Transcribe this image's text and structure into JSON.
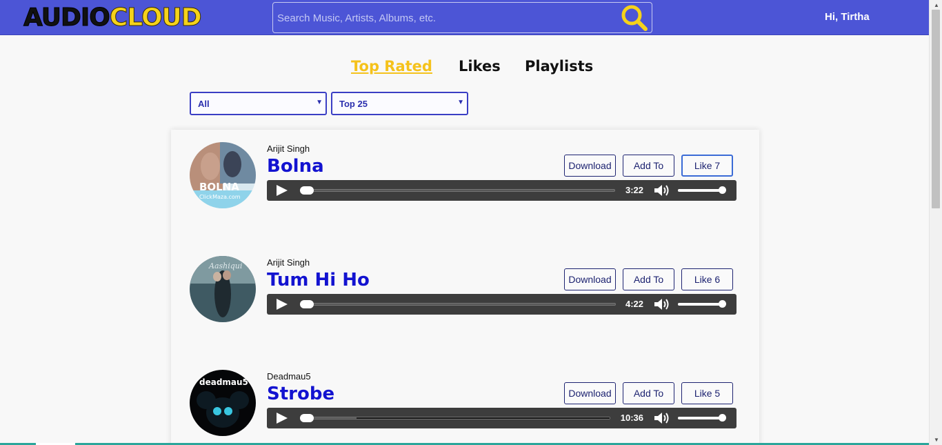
{
  "header": {
    "logo_part1": "AUDIO",
    "logo_part2": "CLOUD",
    "search_placeholder": "Search Music, Artists, Albums, etc.",
    "greeting": "Hi, Tirtha"
  },
  "tabs": [
    {
      "label": "Top Rated",
      "active": true
    },
    {
      "label": "Likes",
      "active": false
    },
    {
      "label": "Playlists",
      "active": false
    }
  ],
  "filters": {
    "genre": "All",
    "count": "Top 25"
  },
  "songs": [
    {
      "artist": "Arijit Singh",
      "title": "Bolna",
      "download": "Download",
      "add": "Add To",
      "like": "Like 7",
      "duration": "3:22",
      "cover": "bolna-cover"
    },
    {
      "artist": "Arijit Singh",
      "title": "Tum Hi Ho",
      "download": "Download",
      "add": "Add To",
      "like": "Like 6",
      "duration": "4:22",
      "cover": "tum-hi-ho-cover"
    },
    {
      "artist": "Deadmau5",
      "title": "Strobe",
      "download": "Download",
      "add": "Add To",
      "like": "Like 5",
      "duration": "10:36",
      "cover": "deadmau5-cover",
      "cover_text": "deadmau5",
      "buffered_fraction": 0.18
    }
  ],
  "colors": {
    "header_bg": "#4c55d6",
    "logo_accent": "#f5d21b",
    "active_tab": "#f5c21b",
    "title_blue": "#1313d0",
    "player_bg": "#3d3d3d"
  },
  "icons": {
    "search": "magnifier-icon",
    "play": "play-icon",
    "volume": "volume-icon"
  }
}
